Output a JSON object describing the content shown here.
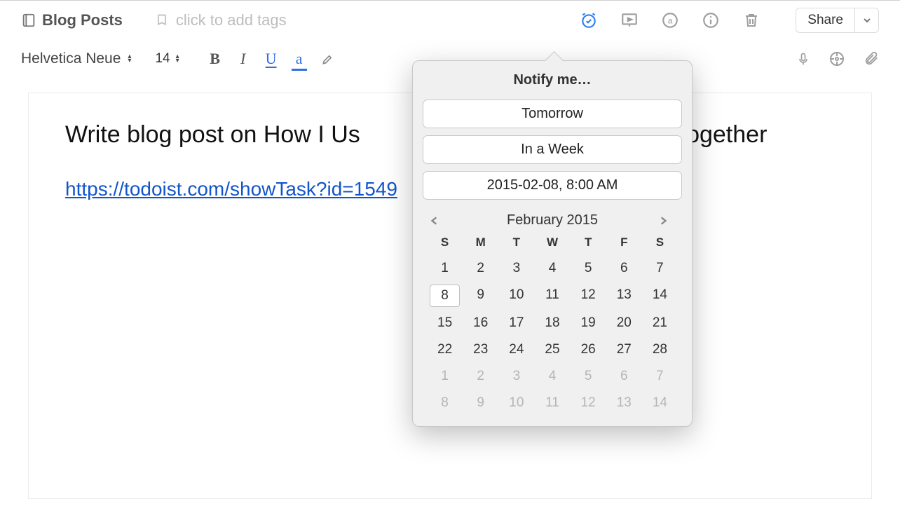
{
  "topbar": {
    "notebook_label": "Blog Posts",
    "tags_placeholder": "click to add tags",
    "share_label": "Share"
  },
  "format": {
    "font_name": "Helvetica Neue",
    "font_size": "14"
  },
  "document": {
    "title_left": "Write blog post on How I Us",
    "title_right": "Together",
    "link_text": "https://todoist.com/showTask?id=1549"
  },
  "popover": {
    "title": "Notify me…",
    "tomorrow_label": "Tomorrow",
    "in_a_week_label": "In a Week",
    "date_value": "2015-02-08,   8:00 AM",
    "month_label": "February 2015",
    "dow": [
      "S",
      "M",
      "T",
      "W",
      "T",
      "F",
      "S"
    ],
    "weeks": [
      [
        {
          "n": "1"
        },
        {
          "n": "2"
        },
        {
          "n": "3"
        },
        {
          "n": "4"
        },
        {
          "n": "5"
        },
        {
          "n": "6"
        },
        {
          "n": "7"
        }
      ],
      [
        {
          "n": "8",
          "sel": true
        },
        {
          "n": "9"
        },
        {
          "n": "10"
        },
        {
          "n": "11"
        },
        {
          "n": "12"
        },
        {
          "n": "13"
        },
        {
          "n": "14"
        }
      ],
      [
        {
          "n": "15"
        },
        {
          "n": "16"
        },
        {
          "n": "17"
        },
        {
          "n": "18"
        },
        {
          "n": "19"
        },
        {
          "n": "20"
        },
        {
          "n": "21"
        }
      ],
      [
        {
          "n": "22"
        },
        {
          "n": "23"
        },
        {
          "n": "24"
        },
        {
          "n": "25"
        },
        {
          "n": "26"
        },
        {
          "n": "27"
        },
        {
          "n": "28"
        }
      ],
      [
        {
          "n": "1",
          "m": true
        },
        {
          "n": "2",
          "m": true
        },
        {
          "n": "3",
          "m": true
        },
        {
          "n": "4",
          "m": true
        },
        {
          "n": "5",
          "m": true
        },
        {
          "n": "6",
          "m": true
        },
        {
          "n": "7",
          "m": true
        }
      ],
      [
        {
          "n": "8",
          "m": true
        },
        {
          "n": "9",
          "m": true
        },
        {
          "n": "10",
          "m": true
        },
        {
          "n": "11",
          "m": true
        },
        {
          "n": "12",
          "m": true
        },
        {
          "n": "13",
          "m": true
        },
        {
          "n": "14",
          "m": true
        }
      ]
    ]
  }
}
